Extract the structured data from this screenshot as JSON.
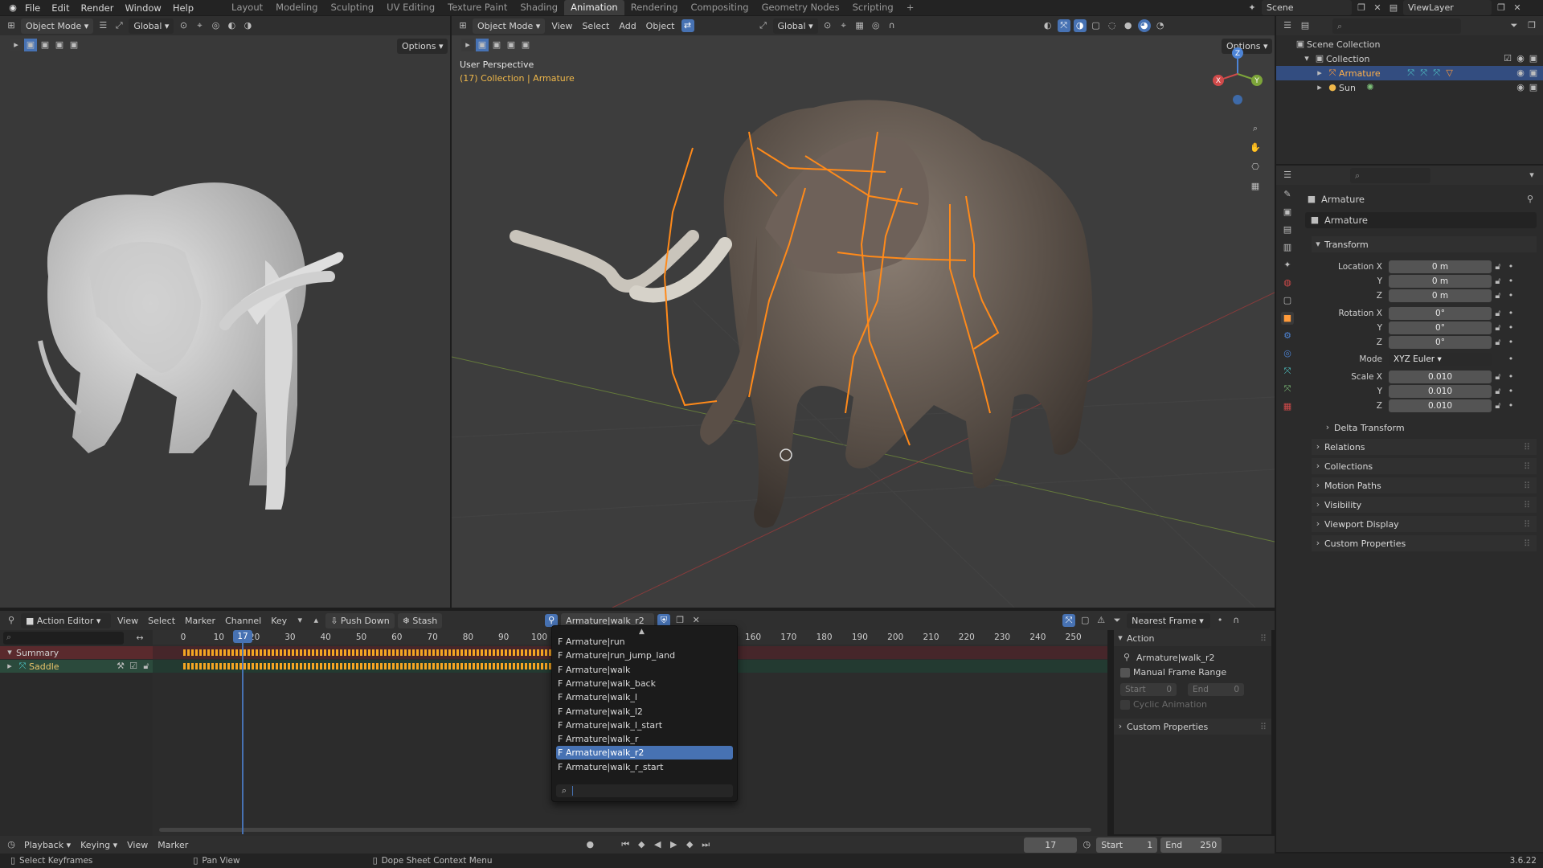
{
  "menubar": {
    "menus": [
      "File",
      "Edit",
      "Render",
      "Window",
      "Help"
    ],
    "workspaces": [
      "Layout",
      "Modeling",
      "Sculpting",
      "UV Editing",
      "Texture Paint",
      "Shading",
      "Animation",
      "Rendering",
      "Compositing",
      "Geometry Nodes",
      "Scripting"
    ],
    "active_workspace": "Animation",
    "add_tab": "+",
    "scene": "Scene",
    "view_layer": "ViewLayer"
  },
  "left_viewport": {
    "mode": "Object Mode",
    "orientation": "Global",
    "options": "Options"
  },
  "main_viewport": {
    "mode": "Object Mode",
    "menus": [
      "View",
      "Select",
      "Add",
      "Object"
    ],
    "orientation": "Global",
    "options": "Options",
    "perspective_label": "User Perspective",
    "collection_label": "(17) Collection | Armature",
    "gizmo": {
      "x": "X",
      "y": "Y",
      "z": "Z"
    }
  },
  "outliner": {
    "root": "Scene Collection",
    "collection": "Collection",
    "items": [
      {
        "name": "Armature",
        "selected": true
      },
      {
        "name": "Sun",
        "selected": false
      }
    ]
  },
  "properties": {
    "object_name": "Armature",
    "data_name": "Armature",
    "transform_title": "Transform",
    "location": {
      "label": "Location X",
      "x": "0 m",
      "y": "0 m",
      "z": "0 m"
    },
    "rotation": {
      "label": "Rotation X",
      "x": "0°",
      "y": "0°",
      "z": "0°"
    },
    "mode": {
      "label": "Mode",
      "value": "XYZ Euler"
    },
    "scale": {
      "label": "Scale X",
      "x": "0.010",
      "y": "0.010",
      "z": "0.010"
    },
    "axis_y": "Y",
    "axis_z": "Z",
    "delta": "Delta Transform",
    "sections": [
      "Relations",
      "Collections",
      "Motion Paths",
      "Visibility",
      "Viewport Display",
      "Custom Properties"
    ]
  },
  "action_editor": {
    "editor_type": "Action Editor",
    "menus": [
      "View",
      "Select",
      "Marker",
      "Channel",
      "Key"
    ],
    "push_down": "Push Down",
    "stash": "Stash",
    "action_name": "Armature|walk_r2",
    "snap": "Nearest Frame",
    "channels": [
      "Summary",
      "Saddle"
    ],
    "ruler_left": [
      "0",
      "10",
      "20",
      "30",
      "40",
      "50",
      "60",
      "70",
      "80",
      "90",
      "100"
    ],
    "ruler_right": [
      "160",
      "170",
      "180",
      "190",
      "200",
      "210",
      "220",
      "230",
      "240",
      "250"
    ],
    "current_frame": "17",
    "action_options": [
      "F Armature|run",
      "F Armature|run_jump_land",
      "F Armature|walk",
      "F Armature|walk_back",
      "F Armature|walk_l",
      "F Armature|walk_l2",
      "F Armature|walk_l_start",
      "F Armature|walk_r",
      "F Armature|walk_r2",
      "F Armature|walk_r_start"
    ],
    "selected_option": "F Armature|walk_r2",
    "sidebar": {
      "action_title": "Action",
      "action_name": "Armature|walk_r2",
      "manual_range": "Manual Frame Range",
      "start_label": "Start",
      "start_value": "0",
      "end_label": "End",
      "end_value": "0",
      "cyclic": "Cyclic Animation",
      "custom_props": "Custom Properties"
    }
  },
  "timeline": {
    "menus": [
      "Playback",
      "Keying",
      "View",
      "Marker"
    ],
    "current_frame": "17",
    "start_label": "Start",
    "start_value": "1",
    "end_label": "End",
    "end_value": "250"
  },
  "statusbar": {
    "left": "Select Keyframes",
    "middle": "Pan View",
    "right": "Dope Sheet Context Menu",
    "version": "3.6.22"
  },
  "colors": {
    "accent_blue": "#4772b3",
    "bone_orange": "#ff8a1a",
    "summary_row": "#5a2a2d",
    "saddle_row": "#2b4a3c"
  }
}
